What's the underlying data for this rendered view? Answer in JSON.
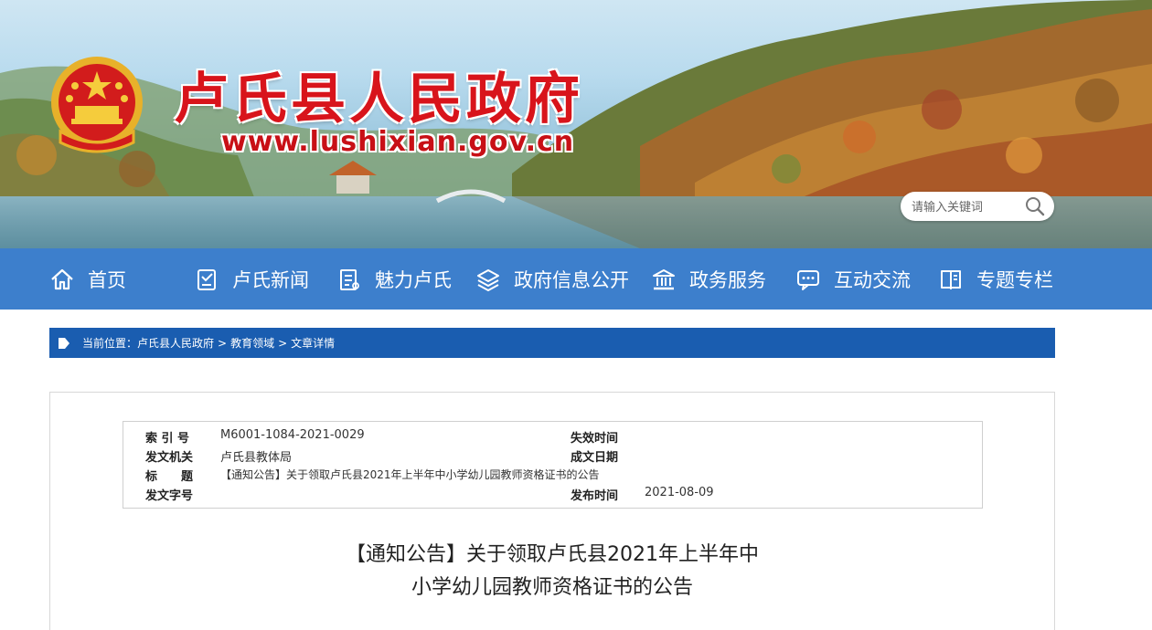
{
  "header": {
    "site_title": "卢氏县人民政府",
    "site_url": "www.lushixian.gov.cn",
    "emblem_icon": "national-emblem-icon"
  },
  "search": {
    "placeholder": "请输入关键词",
    "button_icon": "search-icon"
  },
  "nav": {
    "items": [
      {
        "label": "首页",
        "icon": "home-icon"
      },
      {
        "label": "卢氏新闻",
        "icon": "news-icon"
      },
      {
        "label": "魅力卢氏",
        "icon": "document-list-icon"
      },
      {
        "label": "政府信息公开",
        "icon": "layers-icon"
      },
      {
        "label": "政务服务",
        "icon": "government-building-icon"
      },
      {
        "label": "互动交流",
        "icon": "chat-icon"
      },
      {
        "label": "专题专栏",
        "icon": "book-icon"
      }
    ]
  },
  "breadcrumb": {
    "prefix": "当前位置：",
    "items": [
      "卢氏县人民政府",
      "教育领域",
      "文章详情"
    ],
    "separator": ">"
  },
  "meta": {
    "index_label": "索 引 号",
    "index_value": "M6001-1084-2021-0029",
    "expire_label": "失效时间",
    "expire_value": "",
    "issuer_label": "发文机关",
    "issuer_value": "卢氏县教体局",
    "created_label": "成文日期",
    "created_value": "",
    "title_label": "标　　题",
    "title_value": "【通知公告】关于领取卢氏县2021年上半年中小学幼儿园教师资格证书的公告",
    "doc_no_label": "发文字号",
    "doc_no_value": "",
    "publish_label": "发布时间",
    "publish_value": "2021-08-09"
  },
  "article": {
    "title_line1": "【通知公告】关于领取卢氏县2021年上半年中",
    "title_line2": "小学幼儿园教师资格证书的公告"
  },
  "colors": {
    "title_red": "#d8141b",
    "nav_blue": "#3d7fcc",
    "crumb_blue": "#1a5db0"
  }
}
